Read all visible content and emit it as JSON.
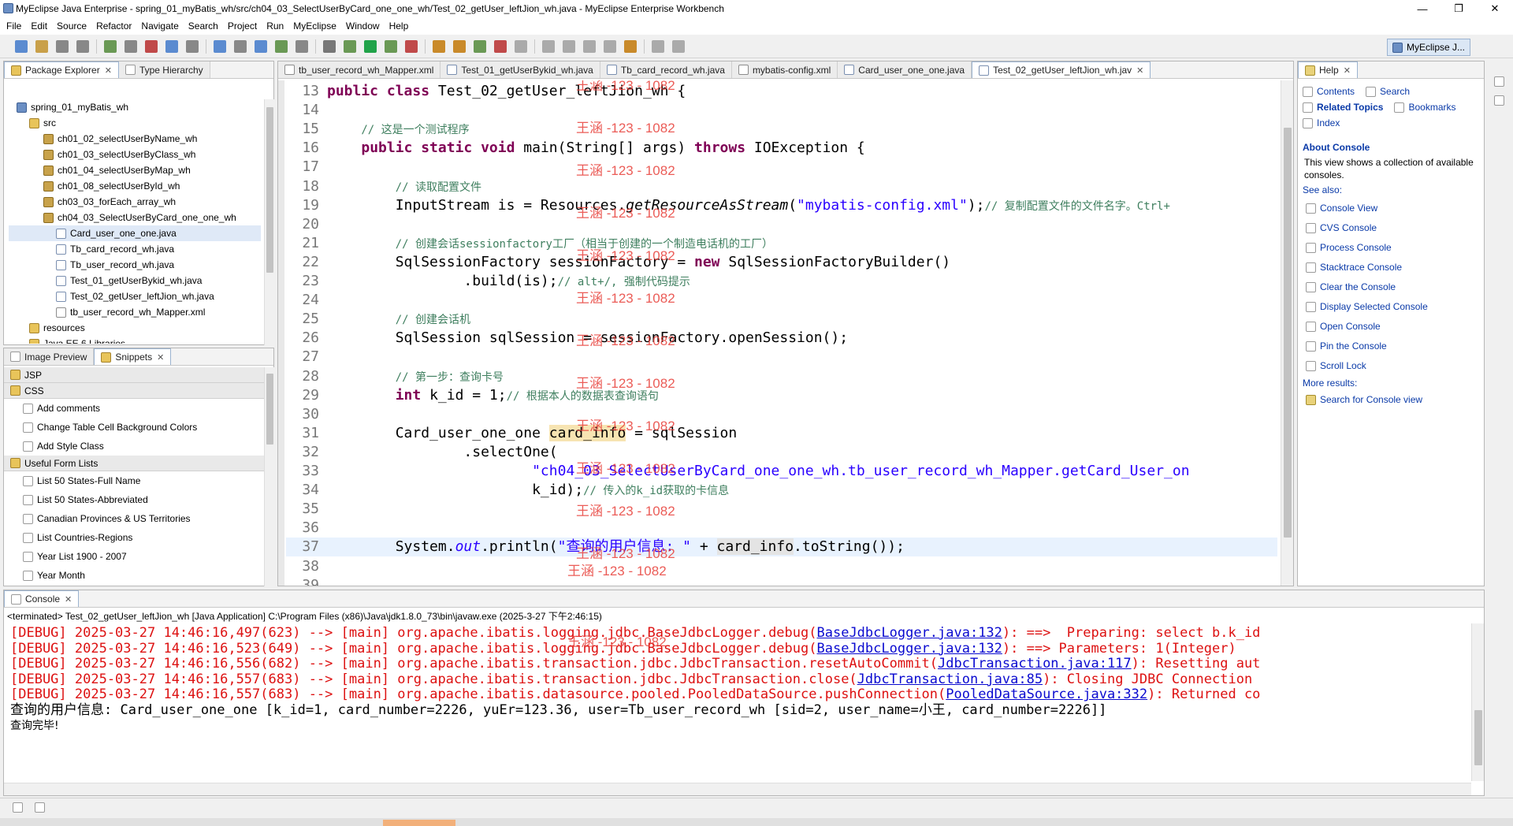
{
  "window": {
    "title": "MyEclipse Java Enterprise - spring_01_myBatis_wh/src/ch04_03_SelectUserByCard_one_one_wh/Test_02_getUser_leftJion_wh.java - MyEclipse Enterprise Workbench",
    "minimize": "—",
    "maximize": "❐",
    "close": "✕"
  },
  "menu": [
    "File",
    "Edit",
    "Source",
    "Refactor",
    "Navigate",
    "Search",
    "Project",
    "Run",
    "MyEclipse",
    "Window",
    "Help"
  ],
  "perspective": "MyEclipse J...",
  "package_explorer": {
    "tabs": [
      "Package Explorer",
      "Type Hierarchy"
    ],
    "project": "spring_01_myBatis_wh",
    "src": "src",
    "packages": [
      "ch01_02_selectUserByName_wh",
      "ch01_03_selectUserByClass_wh",
      "ch01_04_selectUserByMap_wh",
      "ch01_08_selectUserById_wh",
      "ch03_03_forEach_array_wh",
      "ch04_03_SelectUserByCard_one_one_wh"
    ],
    "files": [
      "Card_user_one_one.java",
      "Tb_card_record_wh.java",
      "Tb_user_record_wh.java",
      "Test_01_getUserBykid_wh.java",
      "Test_02_getUser_leftJion_wh.java",
      "tb_user_record_wh_Mapper.xml"
    ],
    "resources": "resources",
    "lib": "Java EE 6 Libraries"
  },
  "snippets": {
    "tabs": [
      "Image Preview",
      "Snippets"
    ],
    "groups": [
      {
        "name": "JSP",
        "items": []
      },
      {
        "name": "CSS",
        "items": [
          "Add comments",
          "Change Table Cell Background Colors",
          "Add Style Class"
        ]
      },
      {
        "name": "Useful Form Lists",
        "items": [
          "List 50 States-Full Name",
          "List 50 States-Abbreviated",
          "Canadian Provinces & US Territories",
          "List Countries-Regions",
          "Year List 1900 - 2007",
          "Year Month"
        ]
      }
    ]
  },
  "editor": {
    "tabs": [
      "tb_user_record_wh_Mapper.xml",
      "Test_01_getUserBykid_wh.java",
      "Tb_card_record_wh.java",
      "mybatis-config.xml",
      "Card_user_one_one.java",
      "Test_02_getUser_leftJion_wh.jav"
    ],
    "active_tab": 5,
    "watermark": "王涵 -123 - 1082",
    "lines": [
      {
        "n": "13",
        "parts": [
          [
            "kw",
            "public "
          ],
          [
            "kw",
            "class "
          ],
          [
            "",
            "Test_02_getUser_leftJion_wh {"
          ]
        ]
      },
      {
        "n": "14",
        "parts": []
      },
      {
        "n": "15",
        "parts": [
          [
            "",
            "    "
          ],
          [
            "cm",
            "// 这是一个测试程序"
          ]
        ]
      },
      {
        "n": "16",
        "parts": [
          [
            "",
            "    "
          ],
          [
            "kw",
            "public "
          ],
          [
            "kw",
            "static "
          ],
          [
            "kw",
            "void "
          ],
          [
            "",
            "main(String[] args) "
          ],
          [
            "kw",
            "throws "
          ],
          [
            "",
            "IOException {"
          ]
        ]
      },
      {
        "n": "17",
        "parts": []
      },
      {
        "n": "18",
        "parts": [
          [
            "",
            "        "
          ],
          [
            "cm",
            "// 读取配置文件"
          ]
        ]
      },
      {
        "n": "19",
        "parts": [
          [
            "",
            "        InputStream is = Resources."
          ],
          [
            "it",
            "getResourceAsStream"
          ],
          [
            "",
            "("
          ],
          [
            "str",
            "\"mybatis-config.xml\""
          ],
          [
            "",
            ");"
          ],
          [
            "cm",
            "// 复制配置文件的文件名字。Ctrl+"
          ]
        ]
      },
      {
        "n": "20",
        "parts": []
      },
      {
        "n": "21",
        "parts": [
          [
            "",
            "        "
          ],
          [
            "cm",
            "// 创建会话sessionfactory工厂（相当于创建的一个制造电话机的工厂）"
          ]
        ]
      },
      {
        "n": "22",
        "parts": [
          [
            "",
            "        SqlSessionFactory sessionFactory = "
          ],
          [
            "kw",
            "new "
          ],
          [
            "",
            "SqlSessionFactoryBuilder()"
          ]
        ]
      },
      {
        "n": "23",
        "parts": [
          [
            "",
            "                .build(is);"
          ],
          [
            "cm",
            "// alt+/, 强制代码提示"
          ]
        ]
      },
      {
        "n": "24",
        "parts": []
      },
      {
        "n": "25",
        "parts": [
          [
            "",
            "        "
          ],
          [
            "cm",
            "// 创建会话机"
          ]
        ]
      },
      {
        "n": "26",
        "parts": [
          [
            "",
            "        SqlSession sqlSession = sessionFactory.openSession();"
          ]
        ]
      },
      {
        "n": "27",
        "parts": []
      },
      {
        "n": "28",
        "parts": [
          [
            "",
            "        "
          ],
          [
            "cm",
            "// 第一步：查询卡号"
          ]
        ]
      },
      {
        "n": "29",
        "parts": [
          [
            "",
            "        "
          ],
          [
            "kw",
            "int "
          ],
          [
            "",
            "k_id = 1;"
          ],
          [
            "cm",
            "// 根据本人的数据表查询语句"
          ]
        ]
      },
      {
        "n": "30",
        "parts": []
      },
      {
        "n": "31",
        "parts": [
          [
            "",
            "        Card_user_one_one "
          ],
          [
            "hl",
            "card_info"
          ],
          [
            "",
            " = sqlSession"
          ]
        ]
      },
      {
        "n": "32",
        "parts": [
          [
            "",
            "                .selectOne("
          ]
        ]
      },
      {
        "n": "33",
        "parts": [
          [
            "",
            "                        "
          ],
          [
            "str",
            "\"ch04_03_SelectUserByCard_one_one_wh.tb_user_record_wh_Mapper.getCard_User_on"
          ]
        ]
      },
      {
        "n": "34",
        "parts": [
          [
            "",
            "                        k_id);"
          ],
          [
            "cm",
            "// 传入的k_id获取的卡信息"
          ]
        ]
      },
      {
        "n": "35",
        "parts": []
      },
      {
        "n": "36",
        "parts": []
      },
      {
        "n": "37",
        "parts": [
          [
            "",
            "        System."
          ],
          [
            "it str2",
            "out"
          ],
          [
            "",
            ".println("
          ],
          [
            "str",
            "\"查询的用户信息: \""
          ],
          [
            "",
            " + "
          ],
          [
            "hl2",
            "card_info"
          ],
          [
            "",
            ".toString());"
          ]
        ]
      },
      {
        "n": "38",
        "parts": []
      },
      {
        "n": "39",
        "parts": []
      }
    ]
  },
  "help": {
    "tab": "Help",
    "nav": [
      "Contents",
      "Search",
      "Related Topics",
      "Bookmarks",
      "Index"
    ],
    "heading": "About Console",
    "description": "This view shows a collection of available consoles.",
    "see_also": "See also:",
    "links": [
      "Console View",
      "CVS Console",
      "Process Console",
      "Stacktrace Console",
      "Clear the Console",
      "Display Selected Console",
      "Open Console",
      "Pin the Console",
      "Scroll Lock"
    ],
    "more_results": "More results:",
    "search_link": "Search for Console view"
  },
  "console": {
    "tab": "Console",
    "header": "<terminated> Test_02_getUser_leftJion_wh [Java Application] C:\\Program Files (x86)\\Java\\jdk1.8.0_73\\bin\\javaw.exe (2025-3-27 下午2:46:15)",
    "lines": [
      {
        "pre": "[DEBUG] 2025-03-27 14:46:16,497(623) --> [main] org.apache.ibatis.logging.jdbc.BaseJdbcLogger.debug(",
        "link": "BaseJdbcLogger.java:132",
        "post": "): ==>  Preparing: select b.k_id"
      },
      {
        "pre": "[DEBUG] 2025-03-27 14:46:16,523(649) --> [main] org.apache.ibatis.logging.jdbc.BaseJdbcLogger.debug(",
        "link": "BaseJdbcLogger.java:132",
        "post": "): ==> Parameters: 1(Integer)"
      },
      {
        "pre": "[DEBUG] 2025-03-27 14:46:16,556(682) --> [main] org.apache.ibatis.transaction.jdbc.JdbcTransaction.resetAutoCommit(",
        "link": "JdbcTransaction.java:117",
        "post": "): Resetting aut"
      },
      {
        "pre": "[DEBUG] 2025-03-27 14:46:16,557(683) --> [main] org.apache.ibatis.transaction.jdbc.JdbcTransaction.close(",
        "link": "JdbcTransaction.java:85",
        "post": "): Closing JDBC Connection"
      },
      {
        "pre": "[DEBUG] 2025-03-27 14:46:16,557(683) --> [main] org.apache.ibatis.datasource.pooled.PooledDataSource.pushConnection(",
        "link": "PooledDataSource.java:332",
        "post": "): Returned co"
      }
    ],
    "output": [
      "查询的用户信息: Card_user_one_one [k_id=1, card_number=2226, yuEr=123.36, user=Tb_user_record_wh [sid=2, user_name=小王, card_number=2226]]",
      "查询完毕!"
    ]
  },
  "colors": {
    "accent": "#0a3aa8",
    "keyword": "#7f0055",
    "comment": "#3f7f5f",
    "string": "#2a00ff",
    "debug": "#d11111"
  }
}
